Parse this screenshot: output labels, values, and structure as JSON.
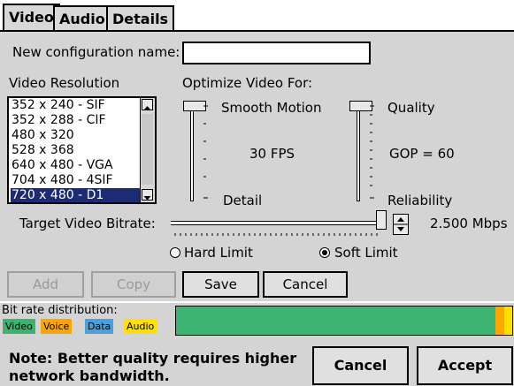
{
  "tabs": [
    {
      "label": "Video",
      "active": true
    },
    {
      "label": "Audio",
      "active": false
    },
    {
      "label": "Details",
      "active": false
    }
  ],
  "config": {
    "label": "New configuration name:",
    "value": ""
  },
  "resolution": {
    "label": "Video Resolution",
    "items": [
      "352 x 240 - SIF",
      "352 x 288 - CIF",
      "480 x 320",
      "528 x 368",
      "640 x 480 - VGA",
      "704 x 480 - 4SIF",
      "720 x 480 - D1"
    ],
    "selected_index": 6
  },
  "optimize": {
    "label": "Optimize Video For:",
    "left_top": "Smooth Motion",
    "left_mid": "30 FPS",
    "left_bottom": "Detail",
    "right_top": "Quality",
    "right_mid": "GOP = 60",
    "right_bottom": "Reliability"
  },
  "bitrate": {
    "label": "Target Video Bitrate:",
    "value": "2.500 Mbps",
    "level": 1.0
  },
  "limit": {
    "hard": "Hard Limit",
    "soft": "Soft Limit",
    "selected": "soft"
  },
  "buttons": {
    "add": "Add",
    "copy": "Copy",
    "save": "Save",
    "cancel_inner": "Cancel",
    "cancel": "Cancel",
    "accept": "Accept"
  },
  "distribution": {
    "label": "Bit rate distribution:",
    "legend": [
      {
        "label": "Video",
        "color": "#3cb371"
      },
      {
        "label": "Voice",
        "color": "#ffa500"
      },
      {
        "label": "Data",
        "color": "#4aa0d8"
      },
      {
        "label": "Audio",
        "color": "#ffe000"
      }
    ],
    "shares": [
      {
        "name": "Video",
        "fraction": 0.95,
        "color": "#3cb371"
      },
      {
        "name": "Voice",
        "fraction": 0.027,
        "color": "#ffa500"
      },
      {
        "name": "Audio",
        "fraction": 0.023,
        "color": "#ffe000"
      }
    ]
  },
  "note": {
    "line1": "Note: Better quality requires higher",
    "line2": "network bandwidth."
  }
}
